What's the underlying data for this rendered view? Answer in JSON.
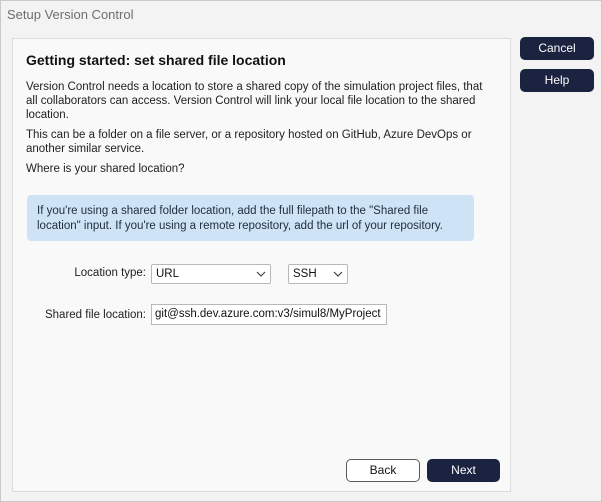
{
  "window": {
    "title": "Setup Version Control"
  },
  "heading": "Getting started: set shared file location",
  "paragraphs": [
    "Version Control needs a location to store a shared copy of the simulation project files, that all collaborators can access. Version Control will link your local file location to the shared location.",
    "This can be a folder on a file server, or a repository hosted on GitHub, Azure DevOps or another similar service.",
    "Where is your shared location?"
  ],
  "info_box": "If you're using a shared folder location, add the full filepath to the \"Shared file location\" input. If you're using a remote repository, add the url of your repository.",
  "form": {
    "location_type_label": "Location type:",
    "location_type_value": "URL",
    "protocol_value": "SSH",
    "shared_location_label": "Shared file location:",
    "shared_location_value": "git@ssh.dev.azure.com:v3/simul8/MyProject"
  },
  "buttons": {
    "back": "Back",
    "next": "Next",
    "cancel": "Cancel",
    "help": "Help"
  },
  "colors": {
    "primary_button": "#1b2340",
    "info_background": "#cfe3f6"
  }
}
